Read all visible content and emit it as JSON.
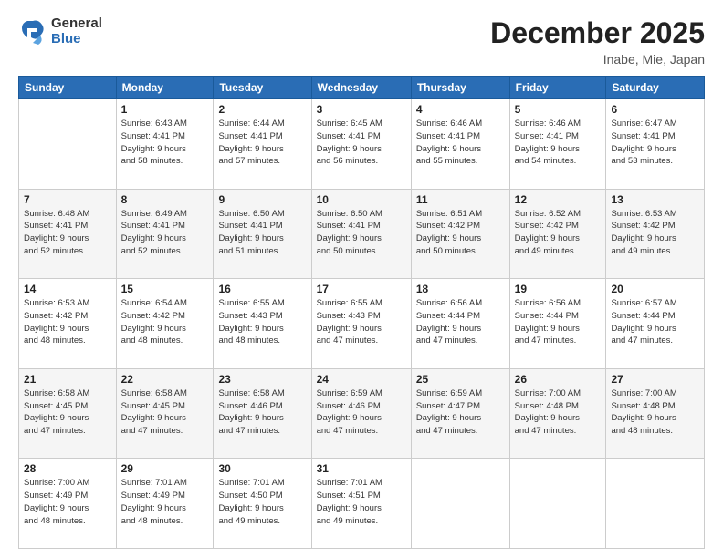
{
  "logo": {
    "general": "General",
    "blue": "Blue"
  },
  "title": {
    "month": "December 2025",
    "location": "Inabe, Mie, Japan"
  },
  "weekdays": [
    "Sunday",
    "Monday",
    "Tuesday",
    "Wednesday",
    "Thursday",
    "Friday",
    "Saturday"
  ],
  "weeks": [
    [
      {
        "day": "",
        "info": ""
      },
      {
        "day": "1",
        "info": "Sunrise: 6:43 AM\nSunset: 4:41 PM\nDaylight: 9 hours\nand 58 minutes."
      },
      {
        "day": "2",
        "info": "Sunrise: 6:44 AM\nSunset: 4:41 PM\nDaylight: 9 hours\nand 57 minutes."
      },
      {
        "day": "3",
        "info": "Sunrise: 6:45 AM\nSunset: 4:41 PM\nDaylight: 9 hours\nand 56 minutes."
      },
      {
        "day": "4",
        "info": "Sunrise: 6:46 AM\nSunset: 4:41 PM\nDaylight: 9 hours\nand 55 minutes."
      },
      {
        "day": "5",
        "info": "Sunrise: 6:46 AM\nSunset: 4:41 PM\nDaylight: 9 hours\nand 54 minutes."
      },
      {
        "day": "6",
        "info": "Sunrise: 6:47 AM\nSunset: 4:41 PM\nDaylight: 9 hours\nand 53 minutes."
      }
    ],
    [
      {
        "day": "7",
        "info": "Sunrise: 6:48 AM\nSunset: 4:41 PM\nDaylight: 9 hours\nand 52 minutes."
      },
      {
        "day": "8",
        "info": "Sunrise: 6:49 AM\nSunset: 4:41 PM\nDaylight: 9 hours\nand 52 minutes."
      },
      {
        "day": "9",
        "info": "Sunrise: 6:50 AM\nSunset: 4:41 PM\nDaylight: 9 hours\nand 51 minutes."
      },
      {
        "day": "10",
        "info": "Sunrise: 6:50 AM\nSunset: 4:41 PM\nDaylight: 9 hours\nand 50 minutes."
      },
      {
        "day": "11",
        "info": "Sunrise: 6:51 AM\nSunset: 4:42 PM\nDaylight: 9 hours\nand 50 minutes."
      },
      {
        "day": "12",
        "info": "Sunrise: 6:52 AM\nSunset: 4:42 PM\nDaylight: 9 hours\nand 49 minutes."
      },
      {
        "day": "13",
        "info": "Sunrise: 6:53 AM\nSunset: 4:42 PM\nDaylight: 9 hours\nand 49 minutes."
      }
    ],
    [
      {
        "day": "14",
        "info": "Sunrise: 6:53 AM\nSunset: 4:42 PM\nDaylight: 9 hours\nand 48 minutes."
      },
      {
        "day": "15",
        "info": "Sunrise: 6:54 AM\nSunset: 4:42 PM\nDaylight: 9 hours\nand 48 minutes."
      },
      {
        "day": "16",
        "info": "Sunrise: 6:55 AM\nSunset: 4:43 PM\nDaylight: 9 hours\nand 48 minutes."
      },
      {
        "day": "17",
        "info": "Sunrise: 6:55 AM\nSunset: 4:43 PM\nDaylight: 9 hours\nand 47 minutes."
      },
      {
        "day": "18",
        "info": "Sunrise: 6:56 AM\nSunset: 4:44 PM\nDaylight: 9 hours\nand 47 minutes."
      },
      {
        "day": "19",
        "info": "Sunrise: 6:56 AM\nSunset: 4:44 PM\nDaylight: 9 hours\nand 47 minutes."
      },
      {
        "day": "20",
        "info": "Sunrise: 6:57 AM\nSunset: 4:44 PM\nDaylight: 9 hours\nand 47 minutes."
      }
    ],
    [
      {
        "day": "21",
        "info": "Sunrise: 6:58 AM\nSunset: 4:45 PM\nDaylight: 9 hours\nand 47 minutes."
      },
      {
        "day": "22",
        "info": "Sunrise: 6:58 AM\nSunset: 4:45 PM\nDaylight: 9 hours\nand 47 minutes."
      },
      {
        "day": "23",
        "info": "Sunrise: 6:58 AM\nSunset: 4:46 PM\nDaylight: 9 hours\nand 47 minutes."
      },
      {
        "day": "24",
        "info": "Sunrise: 6:59 AM\nSunset: 4:46 PM\nDaylight: 9 hours\nand 47 minutes."
      },
      {
        "day": "25",
        "info": "Sunrise: 6:59 AM\nSunset: 4:47 PM\nDaylight: 9 hours\nand 47 minutes."
      },
      {
        "day": "26",
        "info": "Sunrise: 7:00 AM\nSunset: 4:48 PM\nDaylight: 9 hours\nand 47 minutes."
      },
      {
        "day": "27",
        "info": "Sunrise: 7:00 AM\nSunset: 4:48 PM\nDaylight: 9 hours\nand 48 minutes."
      }
    ],
    [
      {
        "day": "28",
        "info": "Sunrise: 7:00 AM\nSunset: 4:49 PM\nDaylight: 9 hours\nand 48 minutes."
      },
      {
        "day": "29",
        "info": "Sunrise: 7:01 AM\nSunset: 4:49 PM\nDaylight: 9 hours\nand 48 minutes."
      },
      {
        "day": "30",
        "info": "Sunrise: 7:01 AM\nSunset: 4:50 PM\nDaylight: 9 hours\nand 49 minutes."
      },
      {
        "day": "31",
        "info": "Sunrise: 7:01 AM\nSunset: 4:51 PM\nDaylight: 9 hours\nand 49 minutes."
      },
      {
        "day": "",
        "info": ""
      },
      {
        "day": "",
        "info": ""
      },
      {
        "day": "",
        "info": ""
      }
    ]
  ]
}
